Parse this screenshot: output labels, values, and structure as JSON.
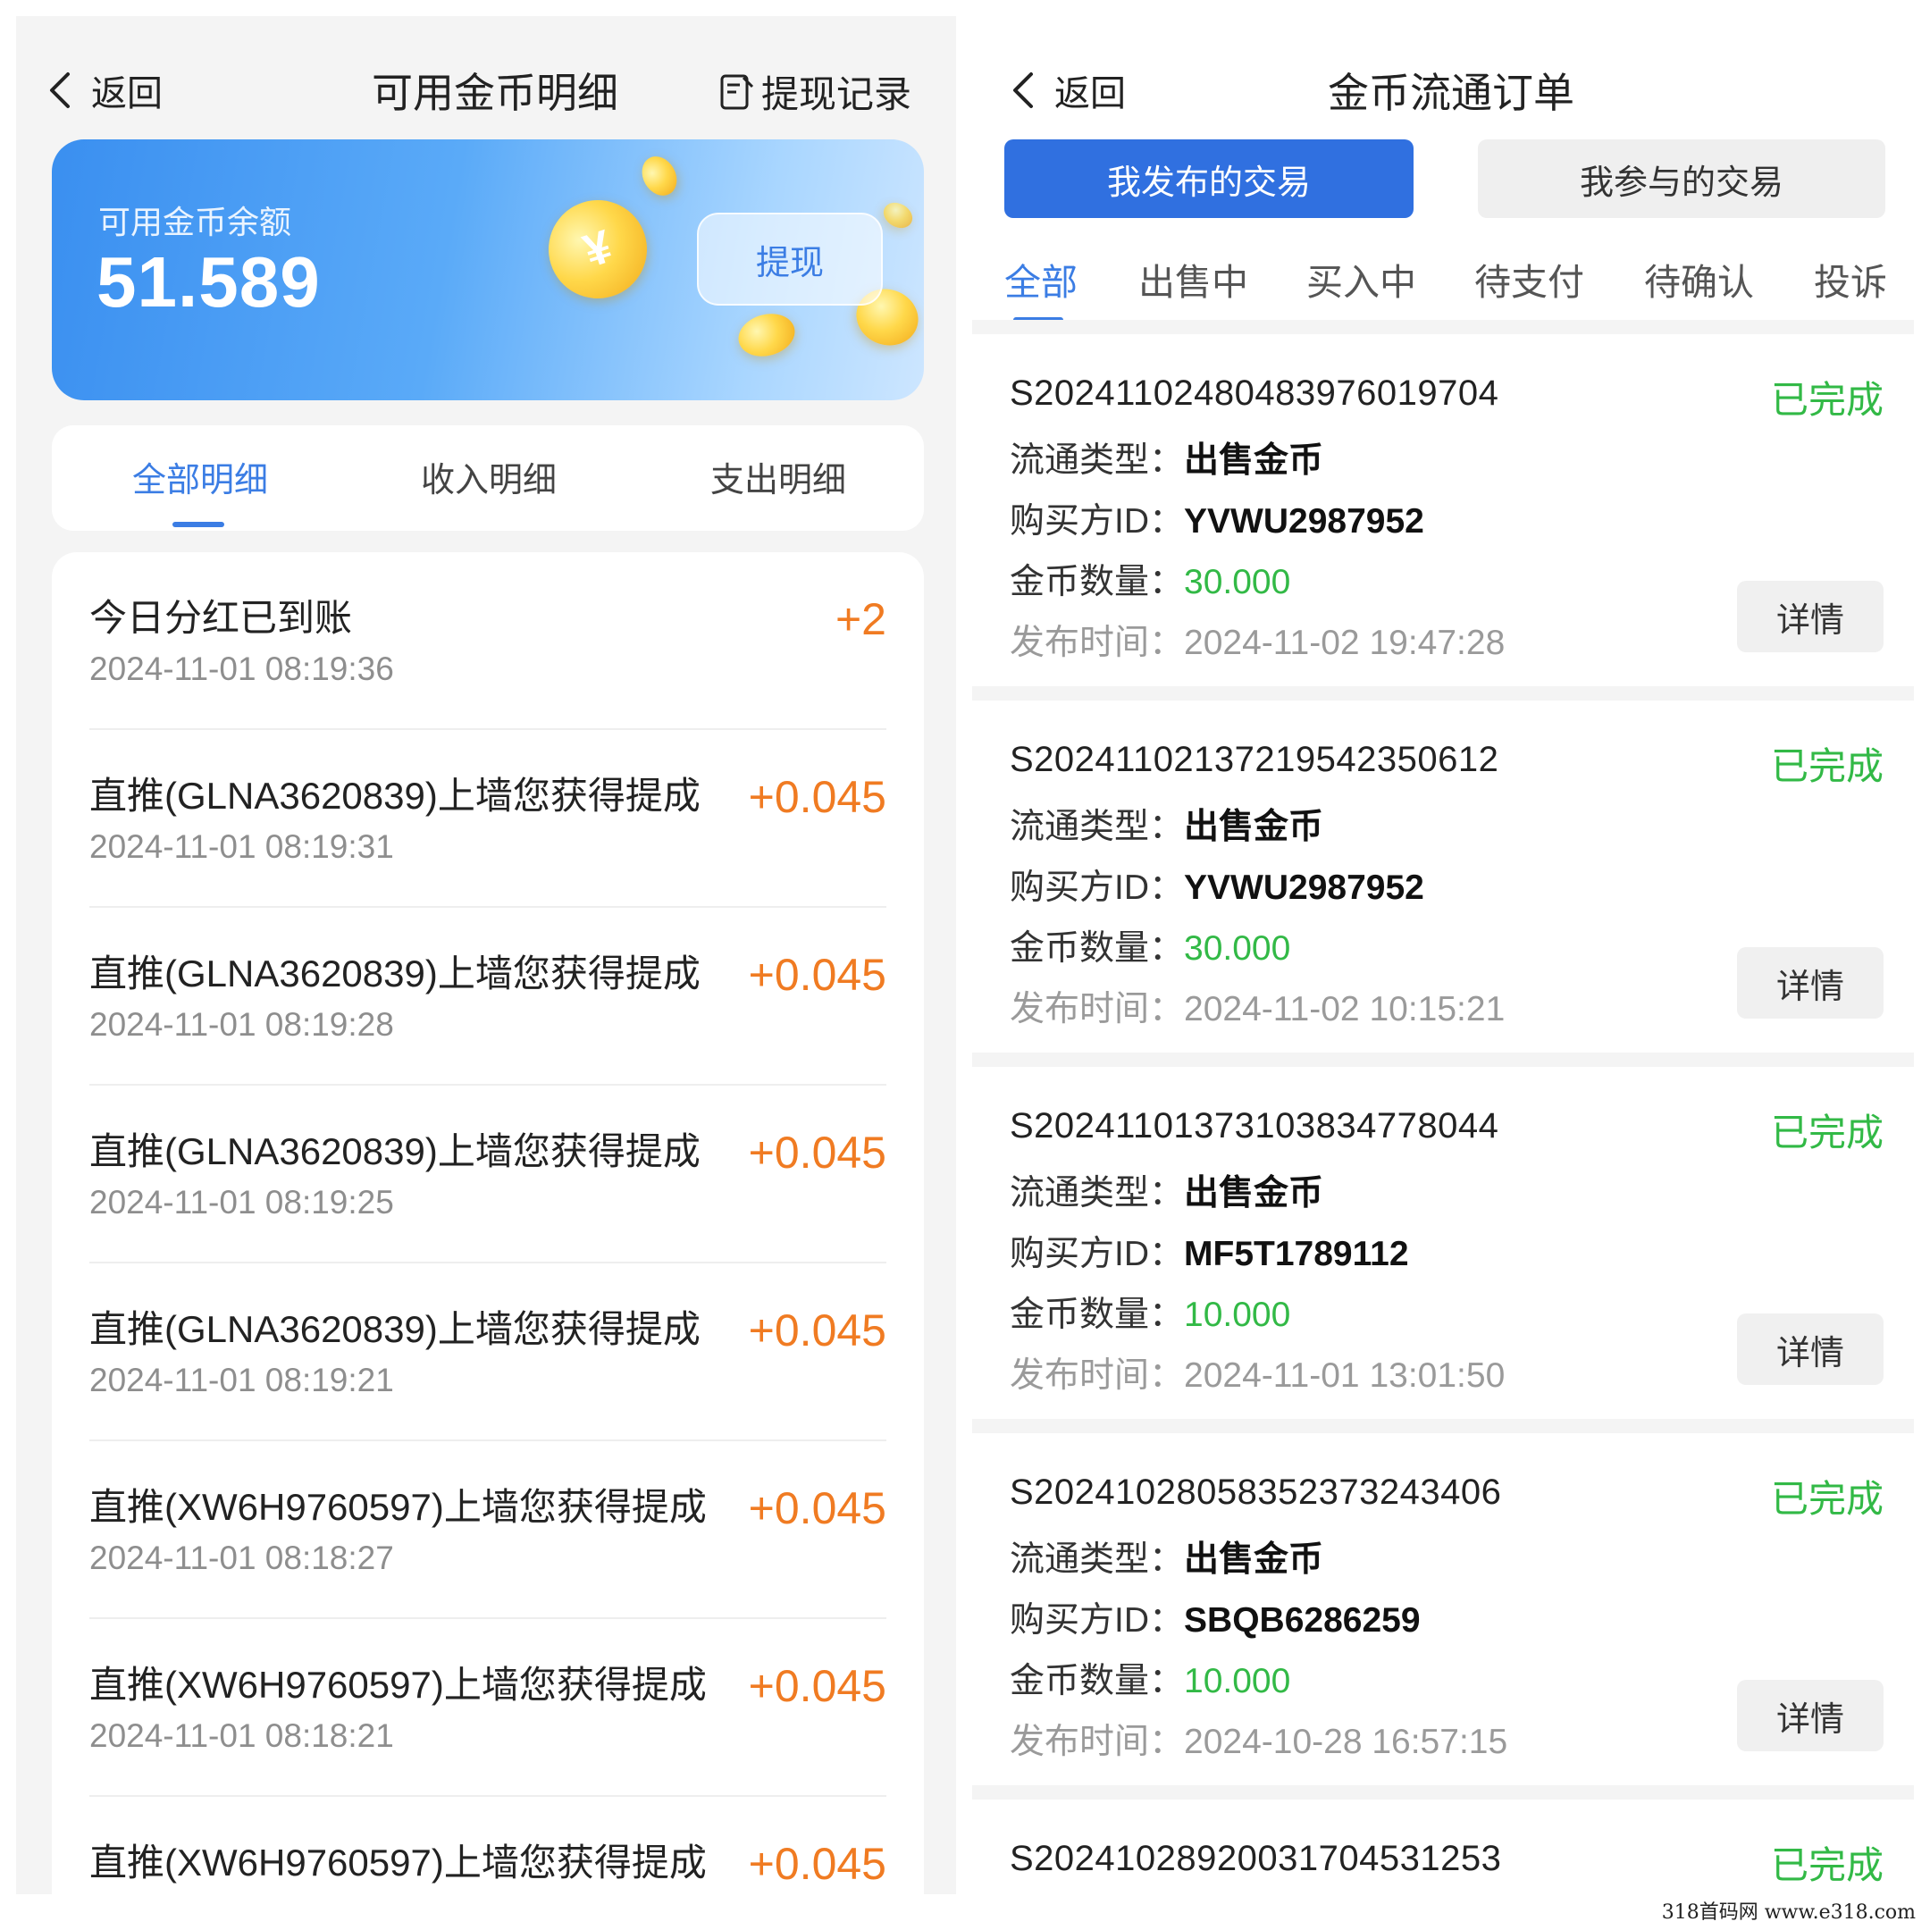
{
  "left": {
    "back_label": "返回",
    "title": "可用金币明细",
    "withdraw_record": "提现记录",
    "balance_label": "可用金币余额",
    "balance_value": "51.589",
    "withdraw_button": "提现",
    "tabs": [
      "全部明细",
      "收入明细",
      "支出明细"
    ],
    "active_tab": 0,
    "items": [
      {
        "title": "今日分红已到账",
        "time": "2024-11-01 08:19:36",
        "amount": "+2"
      },
      {
        "title": "直推(GLNA3620839)上墙您获得提成",
        "time": "2024-11-01 08:19:31",
        "amount": "+0.045"
      },
      {
        "title": "直推(GLNA3620839)上墙您获得提成",
        "time": "2024-11-01 08:19:28",
        "amount": "+0.045"
      },
      {
        "title": "直推(GLNA3620839)上墙您获得提成",
        "time": "2024-11-01 08:19:25",
        "amount": "+0.045"
      },
      {
        "title": "直推(GLNA3620839)上墙您获得提成",
        "time": "2024-11-01 08:19:21",
        "amount": "+0.045"
      },
      {
        "title": "直推(XW6H9760597)上墙您获得提成",
        "time": "2024-11-01 08:18:27",
        "amount": "+0.045"
      },
      {
        "title": "直推(XW6H9760597)上墙您获得提成",
        "time": "2024-11-01 08:18:21",
        "amount": "+0.045"
      },
      {
        "title": "直推(XW6H9760597)上墙您获得提成",
        "time": "",
        "amount": "+0.045"
      }
    ]
  },
  "right": {
    "back_label": "返回",
    "title": "金币流通订单",
    "segments": [
      "我发布的交易",
      "我参与的交易"
    ],
    "status_tabs": [
      "全部",
      "出售中",
      "买入中",
      "待支付",
      "待确认",
      "投诉"
    ],
    "active_status_tab": 0,
    "labels": {
      "type": "流通类型：",
      "buyer": "购买方ID：",
      "amount": "金币数量：",
      "time": "发布时间：",
      "detail_button": "详情"
    },
    "orders": [
      {
        "no": "S2024110248048397601970​4",
        "status": "已完成",
        "type": "出售金币",
        "buyer": "YVWU2987952",
        "amount": "30.000",
        "time": "2024-11-02 19:47:28"
      },
      {
        "no": "S20241102137219542350612",
        "status": "已完成",
        "type": "出售金币",
        "buyer": "YVWU2987952",
        "amount": "30.000",
        "time": "2024-11-02 10:15:21"
      },
      {
        "no": "S20241101373103834778044",
        "status": "已完成",
        "type": "出售金币",
        "buyer": "MF5T1789112",
        "amount": "10.000",
        "time": "2024-11-01 13:01:50"
      },
      {
        "no": "S20241028058352373243406",
        "status": "已完成",
        "type": "出售金币",
        "buyer": "SBQB6286259",
        "amount": "10.000",
        "time": "2024-10-28 16:57:15"
      },
      {
        "no": "S20241028920031704531253",
        "status": "已完成",
        "type": "",
        "buyer": "",
        "amount": "",
        "time": ""
      }
    ]
  },
  "watermark": "318首码网  www.e318.com",
  "colors": {
    "accent": "#3b7de4",
    "primary_button": "#3070e0",
    "income": "#f07b22",
    "completed": "#32b946"
  }
}
